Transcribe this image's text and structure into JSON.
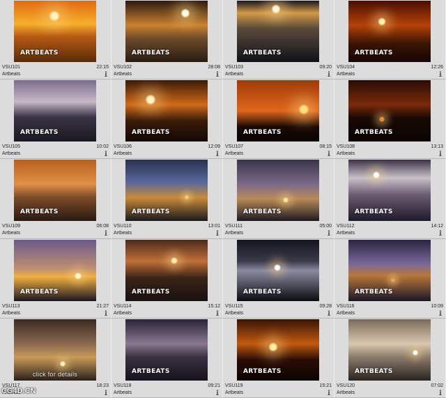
{
  "watermark": "ARTBEATS",
  "site_label": "CG4D.CN",
  "clips": [
    {
      "code": "VSU101",
      "duration": "22:15",
      "source": "Artbeats",
      "bg": "linear-gradient(180deg,#e06a10 0%,#f6b02c 38%,#b75a14 58%,#5a2b08 100%)",
      "sun": "#fff4c0"
    },
    {
      "code": "VSU102",
      "duration": "28:08",
      "source": "Artbeats",
      "bg": "linear-gradient(180deg,#2c1a10 0%,#c98230 40%,#6b4a2a 62%,#2a1c12 100%)",
      "sun": "#fffbe0"
    },
    {
      "code": "VSU103",
      "duration": "09:20",
      "source": "Artbeats",
      "bg": "linear-gradient(180deg,#1a1620 0%,#d19a48 20%,#5a4a3a 45%,#101218 100%)",
      "sun": "#fff7d6"
    },
    {
      "code": "VSU104",
      "duration": "12:26",
      "source": "Artbeats",
      "bg": "linear-gradient(180deg,#4a0e02 0%,#b44208 40%,#3a1404 70%,#140602 100%)",
      "sun": "#fff2a8"
    },
    {
      "code": "VSU105",
      "duration": "10:02",
      "source": "Artbeats",
      "bg": "linear-gradient(180deg,#7a6c8e 0%,#c8b8c8 35%,#3a3446 60%,#1a1820 100%)",
      "sun": "#f4e4d0"
    },
    {
      "code": "VSU106",
      "duration": "12:09",
      "source": "Artbeats",
      "bg": "linear-gradient(180deg,#3a1a08 0%,#d06a18 40%,#3a1c0a 66%,#120804 100%)",
      "sun": "#fff4c0"
    },
    {
      "code": "VSU107",
      "duration": "08:15",
      "source": "Artbeats",
      "bg": "linear-gradient(180deg,#a03a08 0%,#e0661a 50%,#1a0a04 76%,#080402 100%)",
      "sun": "#ffe080"
    },
    {
      "code": "VSU108",
      "duration": "13:13",
      "source": "Artbeats",
      "bg": "linear-gradient(180deg,#2a0c04 0%,#7a2a0a 40%,#180804 62%,#0a0402 100%)",
      "sun": "#f08a30"
    },
    {
      "code": "VSU109",
      "duration": "06:08",
      "source": "Artbeats",
      "bg": "linear-gradient(180deg,#b8601e 0%,#e09048 40%,#7a4a28 62%,#2a1a12 100%)",
      "sun": "#f8c080"
    },
    {
      "code": "VSU110",
      "duration": "13:01",
      "source": "Artbeats",
      "bg": "linear-gradient(180deg,#2a3050 0%,#5a6a9a 38%,#c88a3a 62%,#1a1a1e 100%)",
      "sun": "#f6c870"
    },
    {
      "code": "VSU111",
      "duration": "05:00",
      "source": "Artbeats",
      "bg": "linear-gradient(180deg,#3a3448 0%,#7a6a88 40%,#b88a58 64%,#1e1a22 100%)",
      "sun": "#fce0a0"
    },
    {
      "code": "VSU112",
      "duration": "14:12",
      "source": "Artbeats",
      "bg": "linear-gradient(180deg,#3a3246 0%,#c8c0c8 30%,#6a5a70 58%,#1e1a28 100%)",
      "sun": "#ffffff"
    },
    {
      "code": "VSU113",
      "duration": "21:27",
      "source": "Artbeats",
      "bg": "linear-gradient(180deg,#6a5a8a 0%,#c09070 48%,#f0b040 60%,#1a1622 100%)",
      "sun": "#fff4d0"
    },
    {
      "code": "VSU114",
      "duration": "15:12",
      "source": "Artbeats",
      "bg": "linear-gradient(180deg,#4a2a1c 0%,#c07038 35%,#3a2418 62%,#181010 100%)",
      "sun": "#ffe8b0"
    },
    {
      "code": "VSU115",
      "duration": "09:28",
      "source": "Artbeats",
      "bg": "linear-gradient(180deg,#141420 0%,#3a3a4a 35%,#8a8aa0 50%,#0c0c12 100%)",
      "sun": "#ffffff"
    },
    {
      "code": "VSU116",
      "duration": "10:09",
      "source": "Artbeats",
      "bg": "linear-gradient(180deg,#2a2440 0%,#7a6a9a 40%,#b8783a 58%,#1a1628 100%)",
      "sun": "#f0a050"
    },
    {
      "code": "VSU117",
      "duration": "18:23",
      "source": "Artbeats",
      "bg": "linear-gradient(180deg,#3a2a22 0%,#8a6a50 40%,#c89a58 62%,#2a201a 100%)",
      "sun": "#fff0c0",
      "details": "click for details"
    },
    {
      "code": "VSU118",
      "duration": "09:21",
      "source": "Artbeats",
      "bg": "linear-gradient(180deg,#2a2438 0%,#8a7890 40%,#3a3040 62%,#16121c 100%)",
      "sun": "#f8e8e0"
    },
    {
      "code": "VSU119",
      "duration": "15:21",
      "source": "Artbeats",
      "bg": "linear-gradient(180deg,#3a1404 0%,#c05a10 40%,#2a0c04 66%,#0c0402 100%)",
      "sun": "#fff0a0"
    },
    {
      "code": "VSU120",
      "duration": "07:02",
      "source": "Artbeats",
      "bg": "linear-gradient(180deg,#7a6a5a 0%,#d8c8b0 40%,#8a7a6a 62%,#2a2420 100%)",
      "sun": "#ffffff"
    }
  ]
}
